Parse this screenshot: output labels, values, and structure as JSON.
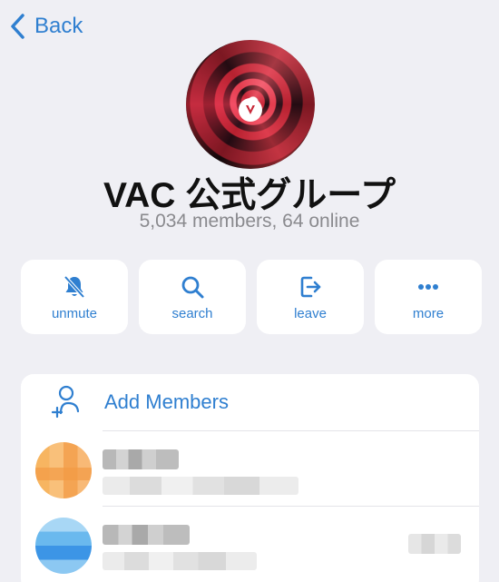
{
  "nav": {
    "back_label": "Back"
  },
  "group": {
    "name": "VAC 公式グループ",
    "status": "5,034 members, 64 online"
  },
  "actions": [
    {
      "label": "unmute",
      "icon": "bell-slash-icon"
    },
    {
      "label": "search",
      "icon": "search-icon"
    },
    {
      "label": "leave",
      "icon": "leave-icon"
    },
    {
      "label": "more",
      "icon": "more-icon"
    }
  ],
  "members": {
    "add_label": "Add Members",
    "list": [
      {
        "avatar_color": "#f5a850"
      },
      {
        "avatar_color": "#4aa3e8"
      }
    ]
  },
  "colors": {
    "accent": "#2f7fd0",
    "background": "#efeff4"
  }
}
